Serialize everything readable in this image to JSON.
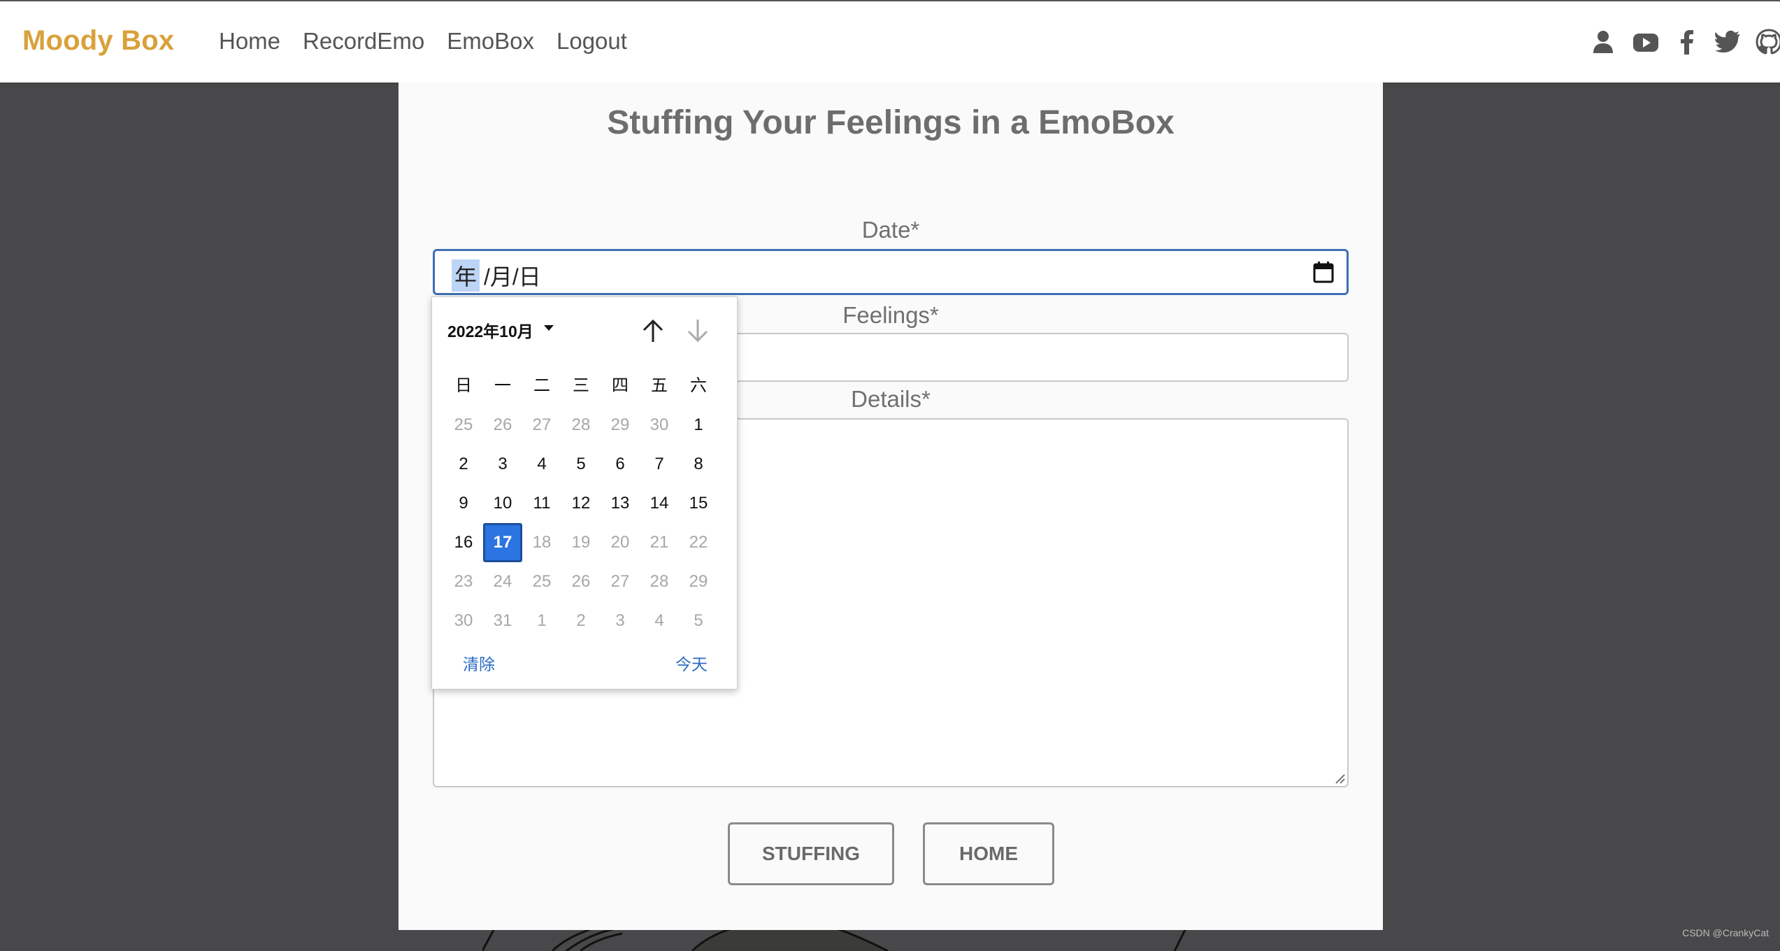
{
  "navbar": {
    "brand": "Moody Box",
    "links": [
      "Home",
      "RecordEmo",
      "EmoBox",
      "Logout"
    ],
    "icons": [
      "user-icon",
      "youtube-icon",
      "facebook-icon",
      "twitter-icon",
      "github-icon"
    ],
    "brand_color": "#d9a13a"
  },
  "form": {
    "title": "Stuffing Your Feelings in a EmoBox",
    "date_label": "Date*",
    "date_value": {
      "year": "年",
      "rest": "/月/日"
    },
    "feelings_label": "Feelings*",
    "feelings_value": "",
    "details_label": "Details*",
    "details_value": "",
    "stuffing_button": "STUFFING",
    "home_button": "HOME"
  },
  "datepicker": {
    "month_label": "2022年10月",
    "weekdays": [
      "日",
      "一",
      "二",
      "三",
      "四",
      "五",
      "六"
    ],
    "days": [
      {
        "d": "25",
        "muted": true
      },
      {
        "d": "26",
        "muted": true
      },
      {
        "d": "27",
        "muted": true
      },
      {
        "d": "28",
        "muted": true
      },
      {
        "d": "29",
        "muted": true
      },
      {
        "d": "30",
        "muted": true
      },
      {
        "d": "1",
        "muted": false
      },
      {
        "d": "2",
        "muted": false
      },
      {
        "d": "3",
        "muted": false
      },
      {
        "d": "4",
        "muted": false
      },
      {
        "d": "5",
        "muted": false
      },
      {
        "d": "6",
        "muted": false
      },
      {
        "d": "7",
        "muted": false
      },
      {
        "d": "8",
        "muted": false
      },
      {
        "d": "9",
        "muted": false
      },
      {
        "d": "10",
        "muted": false
      },
      {
        "d": "11",
        "muted": false
      },
      {
        "d": "12",
        "muted": false
      },
      {
        "d": "13",
        "muted": false
      },
      {
        "d": "14",
        "muted": false
      },
      {
        "d": "15",
        "muted": false
      },
      {
        "d": "16",
        "muted": false
      },
      {
        "d": "17",
        "muted": false,
        "selected": true
      },
      {
        "d": "18",
        "muted": true
      },
      {
        "d": "19",
        "muted": true
      },
      {
        "d": "20",
        "muted": true
      },
      {
        "d": "21",
        "muted": true
      },
      {
        "d": "22",
        "muted": true
      },
      {
        "d": "23",
        "muted": true
      },
      {
        "d": "24",
        "muted": true
      },
      {
        "d": "25",
        "muted": true
      },
      {
        "d": "26",
        "muted": true
      },
      {
        "d": "27",
        "muted": true
      },
      {
        "d": "28",
        "muted": true
      },
      {
        "d": "29",
        "muted": true
      },
      {
        "d": "30",
        "muted": true
      },
      {
        "d": "31",
        "muted": true
      },
      {
        "d": "1",
        "muted": true
      },
      {
        "d": "2",
        "muted": true
      },
      {
        "d": "3",
        "muted": true
      },
      {
        "d": "4",
        "muted": true
      },
      {
        "d": "5",
        "muted": true
      }
    ],
    "clear_label": "清除",
    "today_label": "今天",
    "selected_color": "#2b74e2"
  },
  "watermark": "CSDN @CrankyCat"
}
